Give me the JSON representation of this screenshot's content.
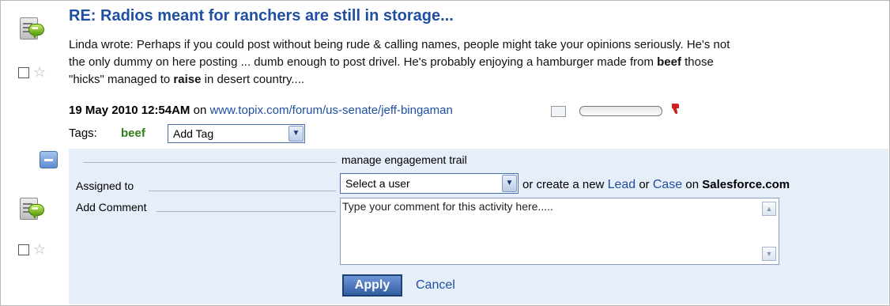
{
  "post": {
    "title": "RE: Radios meant for ranchers are still in storage...",
    "body_line1": "Linda wrote: Perhaps if you could post without being rude & calling names, people might take your opinions seriously. He's not",
    "body_line2_a": "the only dummy on here posting ... dumb enough to post drivel. He's probably enjoying a hamburger made from ",
    "body_line2_bold": "beef",
    "body_line2_b": " those",
    "body_line3_a": "\"hicks\" managed to ",
    "body_line3_bold": "raise",
    "body_line3_b": " in desert country....",
    "date": "19 May 2010 12:54AM",
    "on_text": "on",
    "url": "www.topix.com/forum/us-senate/jeff-bingaman",
    "sentiment_level": 0,
    "tags_label": "Tags:",
    "tag": "beef",
    "add_tag_select": "Add Tag"
  },
  "engagement": {
    "header": "manage engagement trail",
    "assigned_label": "Assigned to",
    "user_select": "Select a user",
    "or_create": "or create a new",
    "lead_link": "Lead",
    "or_text": "or",
    "case_link": "Case",
    "on_text": "on",
    "salesforce": "Salesforce.com",
    "comment_label": "Add Comment",
    "comment_placeholder": "Type your comment for this activity here.....",
    "apply_label": "Apply",
    "cancel_label": "Cancel"
  },
  "icons": {
    "post_icon": "comment-document-icon",
    "star": "star-icon",
    "thumb_down": "thumbs-down-icon",
    "collapse": "minus-icon",
    "dropdown": "chevron-down-icon"
  },
  "colors": {
    "link": "#1f4fa0",
    "tag": "#2e7d16",
    "panel_bg": "#e6eefa",
    "apply_bg": "#325e9f",
    "thumb_down": "#d01f1f"
  }
}
